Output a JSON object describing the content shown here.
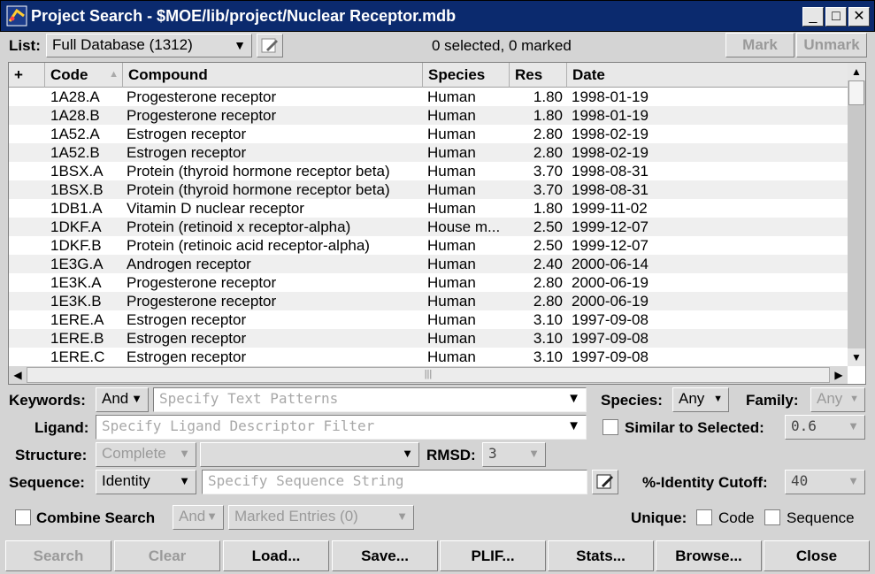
{
  "window": {
    "title": "Project Search - $MOE/lib/project/Nuclear Receptor.mdb",
    "minimize": "_",
    "maximize": "□",
    "close": "✕"
  },
  "list": {
    "label": "List:",
    "selected": "Full Database (1312)",
    "status": "0 selected, 0 marked",
    "mark_label": "Mark",
    "unmark_label": "Unmark"
  },
  "table": {
    "columns": [
      "+",
      "Code",
      "Compound",
      "Species",
      "Res",
      "Date"
    ],
    "rows": [
      {
        "code": "1A28.A",
        "compound": "Progesterone receptor",
        "species": "Human",
        "res": "1.80",
        "date": "1998-01-19"
      },
      {
        "code": "1A28.B",
        "compound": "Progesterone receptor",
        "species": "Human",
        "res": "1.80",
        "date": "1998-01-19"
      },
      {
        "code": "1A52.A",
        "compound": "Estrogen receptor",
        "species": "Human",
        "res": "2.80",
        "date": "1998-02-19"
      },
      {
        "code": "1A52.B",
        "compound": "Estrogen receptor",
        "species": "Human",
        "res": "2.80",
        "date": "1998-02-19"
      },
      {
        "code": "1BSX.A",
        "compound": "Protein (thyroid hormone receptor beta)",
        "species": "Human",
        "res": "3.70",
        "date": "1998-08-31"
      },
      {
        "code": "1BSX.B",
        "compound": "Protein (thyroid hormone receptor beta)",
        "species": "Human",
        "res": "3.70",
        "date": "1998-08-31"
      },
      {
        "code": "1DB1.A",
        "compound": "Vitamin D nuclear receptor",
        "species": "Human",
        "res": "1.80",
        "date": "1999-11-02"
      },
      {
        "code": "1DKF.A",
        "compound": "Protein (retinoid x receptor-alpha)",
        "species": "House m...",
        "res": "2.50",
        "date": "1999-12-07"
      },
      {
        "code": "1DKF.B",
        "compound": "Protein (retinoic acid receptor-alpha)",
        "species": "Human",
        "res": "2.50",
        "date": "1999-12-07"
      },
      {
        "code": "1E3G.A",
        "compound": "Androgen receptor",
        "species": "Human",
        "res": "2.40",
        "date": "2000-06-14"
      },
      {
        "code": "1E3K.A",
        "compound": "Progesterone receptor",
        "species": "Human",
        "res": "2.80",
        "date": "2000-06-19"
      },
      {
        "code": "1E3K.B",
        "compound": "Progesterone receptor",
        "species": "Human",
        "res": "2.80",
        "date": "2000-06-19"
      },
      {
        "code": "1ERE.A",
        "compound": "Estrogen receptor",
        "species": "Human",
        "res": "3.10",
        "date": "1997-09-08"
      },
      {
        "code": "1ERE.B",
        "compound": "Estrogen receptor",
        "species": "Human",
        "res": "3.10",
        "date": "1997-09-08"
      },
      {
        "code": "1ERE.C",
        "compound": "Estrogen receptor",
        "species": "Human",
        "res": "3.10",
        "date": "1997-09-08"
      }
    ]
  },
  "filters": {
    "keywords_label": "Keywords:",
    "keywords_op": "And",
    "keywords_placeholder": "Specify Text Patterns",
    "species_label": "Species:",
    "species_value": "Any",
    "family_label": "Family:",
    "family_value": "Any",
    "ligand_label": "Ligand:",
    "ligand_placeholder": "Specify Ligand Descriptor Filter",
    "similar_label": "Similar to Selected:",
    "similar_value": "0.6",
    "structure_label": "Structure:",
    "structure_value": "Complete",
    "structure_value2": "",
    "rmsd_label": "RMSD:",
    "rmsd_value": "3",
    "sequence_label": "Sequence:",
    "sequence_mode": "Identity",
    "sequence_placeholder": "Specify Sequence String",
    "identity_label": "%-Identity Cutoff:",
    "identity_value": "40",
    "combine_label": "Combine Search",
    "combine_op": "And",
    "combine_target": "Marked Entries (0)",
    "unique_label": "Unique:",
    "unique_code": "Code",
    "unique_sequence": "Sequence"
  },
  "buttons": {
    "search": "Search",
    "clear": "Clear",
    "load": "Load...",
    "save": "Save...",
    "plif": "PLIF...",
    "stats": "Stats...",
    "browse": "Browse...",
    "close": "Close"
  },
  "icons": {
    "app": "moe-app-icon",
    "edit": "pencil-icon",
    "sort": "sort-up-icon",
    "dropdown": "chevron-down-icon"
  }
}
